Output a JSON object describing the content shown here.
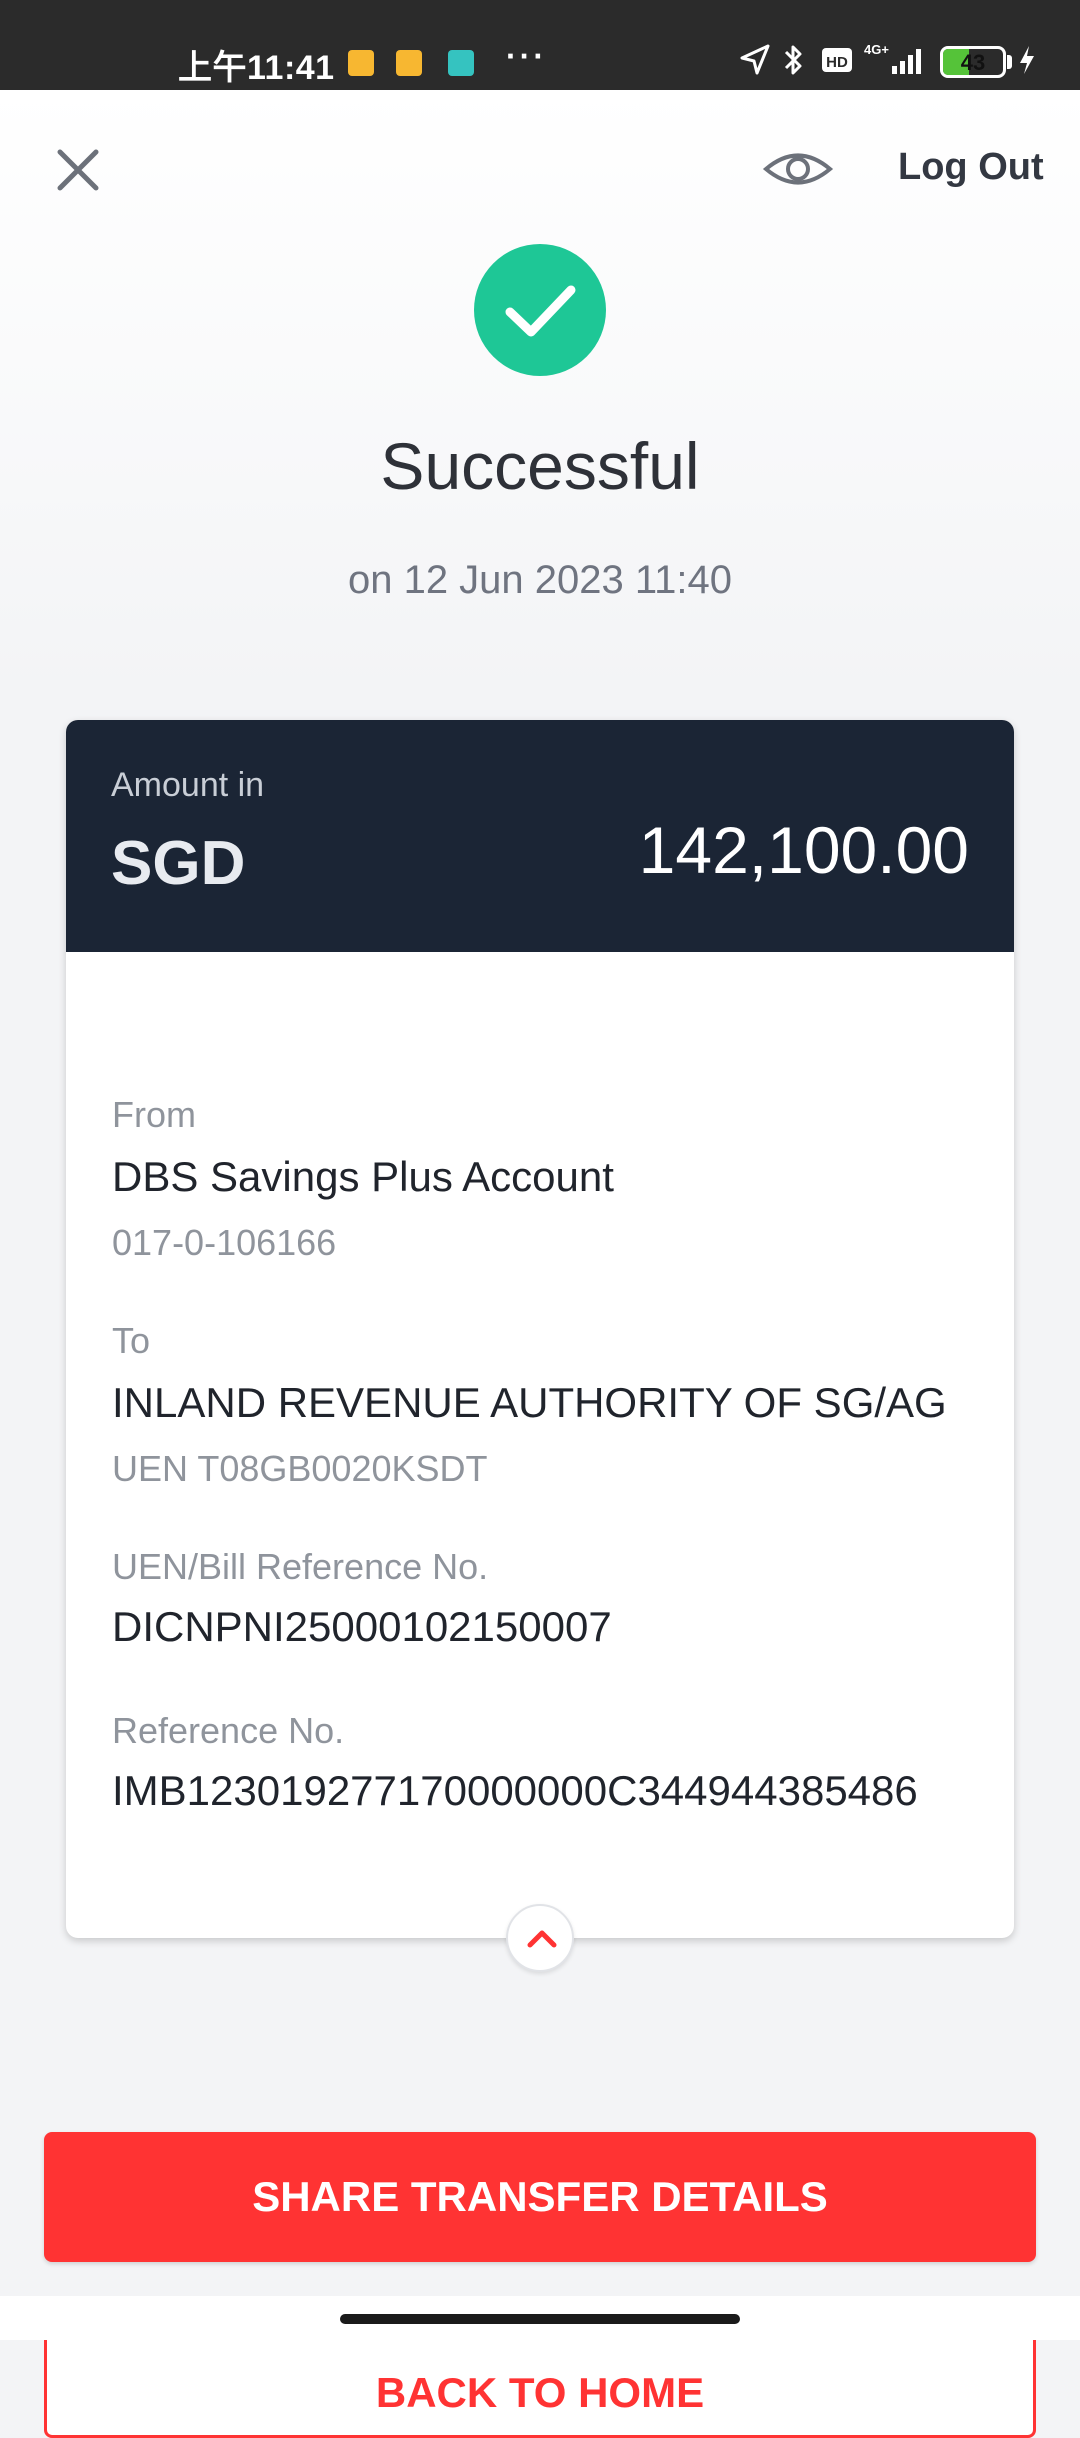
{
  "status_bar": {
    "time": "上午11:41",
    "more": "···",
    "network": "4G+",
    "battery_level": "43",
    "battery_fraction": 0.43
  },
  "header": {
    "close_icon": "close-icon",
    "visibility_icon": "eye-icon",
    "logout_label": "Log Out"
  },
  "result": {
    "title": "Successful",
    "datetime": "on 12 Jun 2023 11:40",
    "status_color": "#1ec796"
  },
  "amount_card": {
    "amount_label": "Amount in",
    "currency": "SGD",
    "amount": "142,100.00"
  },
  "details": {
    "from_label": "From",
    "from_account": "DBS Savings Plus Account",
    "from_account_no": "017-0-106166",
    "to_label": "To",
    "to_name": "INLAND REVENUE AUTHORITY OF SG/AG",
    "to_uen": "UEN T08GB0020KSDT",
    "bill_ref_label": "UEN/Bill Reference No.",
    "bill_ref": "DICNPNI25000102150007",
    "ref_label": "Reference No.",
    "ref_no": "IMB123019277170000000C344944385486"
  },
  "actions": {
    "share_label": "SHARE TRANSFER DETAILS",
    "home_label": "BACK TO HOME",
    "accent_color": "#ff3333"
  }
}
